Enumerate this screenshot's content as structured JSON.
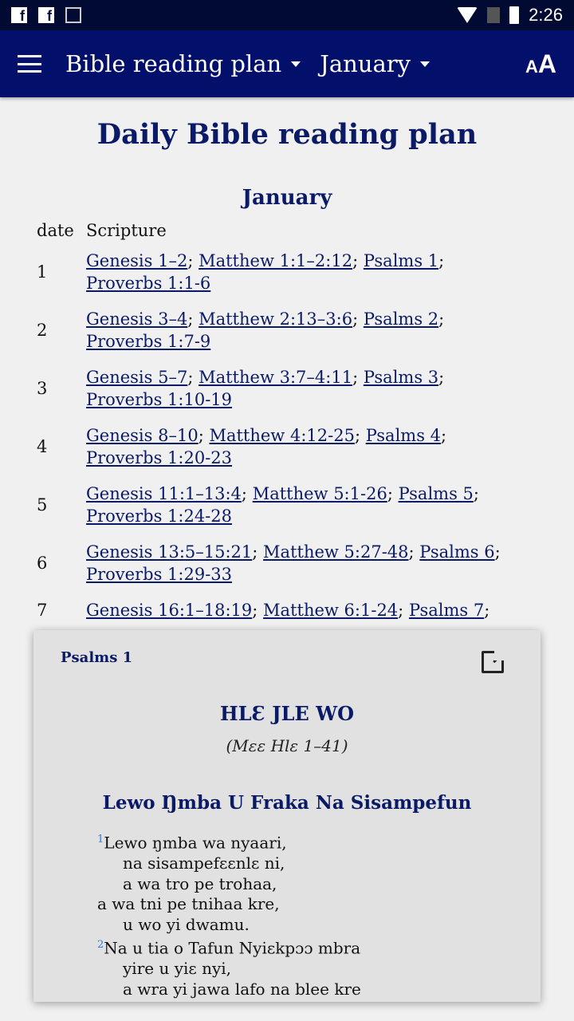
{
  "status_bar": {
    "time": "2:26",
    "icons": [
      "facebook-icon",
      "facebook-icon",
      "image-icon",
      "wifi-icon",
      "no-sim-icon",
      "battery-icon"
    ]
  },
  "app_bar": {
    "menu_icon": "hamburger-icon",
    "plan_dropdown": "Bible reading plan",
    "month_dropdown": "January",
    "text_size_icon": "font-size-icon"
  },
  "page": {
    "title": "Daily Bible reading plan",
    "month": "January",
    "col_date": "date",
    "col_scripture": "Scripture",
    "rows": [
      {
        "date": "1",
        "refs": [
          "Genesis 1–2",
          "Matthew 1:1–2:12",
          "Psalms 1",
          "Proverbs 1:1-6"
        ]
      },
      {
        "date": "2",
        "refs": [
          "Genesis 3–4",
          "Matthew 2:13–3:6",
          "Psalms 2",
          "Proverbs 1:7-9"
        ]
      },
      {
        "date": "3",
        "refs": [
          "Genesis 5–7",
          "Matthew 3:7–4:11",
          "Psalms 3",
          "Proverbs 1:10-19"
        ]
      },
      {
        "date": "4",
        "refs": [
          "Genesis 8–10",
          "Matthew 4:12-25",
          "Psalms 4",
          "Proverbs 1:20-23"
        ]
      },
      {
        "date": "5",
        "refs": [
          "Genesis 11:1–13:4",
          "Matthew 5:1-26",
          "Psalms 5",
          "Proverbs 1:24-28"
        ]
      },
      {
        "date": "6",
        "refs": [
          "Genesis 13:5–15:21",
          "Matthew 5:27-48",
          "Psalms 6",
          "Proverbs 1:29-33"
        ]
      },
      {
        "date": "7",
        "refs": [
          "Genesis 16:1–18:19",
          "Matthew 6:1-24",
          "Psalms 7"
        ]
      }
    ]
  },
  "popup": {
    "reference": "Psalms 1",
    "open_icon": "open-external-icon",
    "book_title": "HLƐ JLE WO",
    "book_subtitle": "(Mɛɛ Hlɛ 1–41)",
    "section": "Lewo Ŋmba U Fraka Na Sisampefun",
    "lines": [
      {
        "v": "1",
        "t": "Lewo ŋmba wa nyaari,",
        "indent": false
      },
      {
        "t": "na sisampefɛɛnlɛ ni,",
        "indent": true
      },
      {
        "t": "a wa tro pe trohaa,",
        "indent": true
      },
      {
        "t": "a wa tni pe tnihaa kre,",
        "indent": false
      },
      {
        "t": "u wo yi dwamu.",
        "indent": true
      },
      {
        "v": "2",
        "t": "Na u tia o Tafun Nyiɛkpɔɔ mbra",
        "indent": false
      },
      {
        "t": "yire u yiɛ nyi,",
        "indent": true
      },
      {
        "t": "a wra yi jawa lafo na blee kre",
        "indent": true
      }
    ]
  },
  "colors": {
    "app_bar": "#020f6b",
    "status_bar": "#010a33",
    "link": "#0b1a66",
    "verse_number": "#3a7ad6"
  }
}
